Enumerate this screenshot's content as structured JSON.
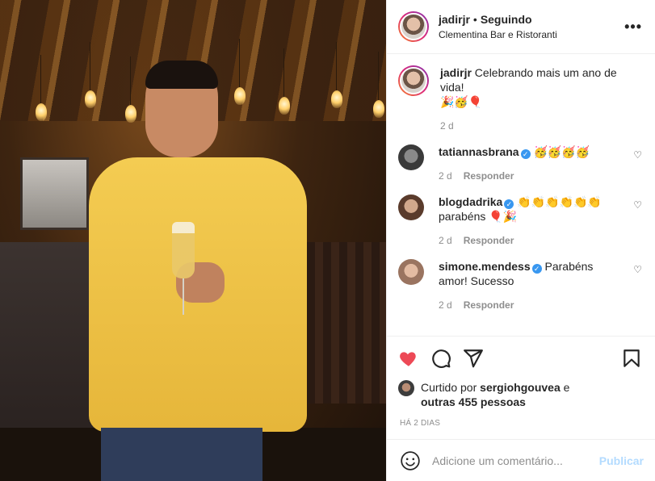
{
  "header": {
    "username": "jadirjr",
    "separator": "•",
    "follow_status": "Seguindo",
    "location": "Clementina Bar e Ristoranti",
    "more_label": "•••"
  },
  "caption": {
    "username": "jadirjr",
    "text": "Celebrando mais um ano de vida!",
    "emojis": "🎉🥳🎈",
    "time": "2 d"
  },
  "comments": [
    {
      "username": "tatiannasbrana",
      "verified": true,
      "text": "🥳🥳🥳🥳",
      "time": "2 d",
      "reply_label": "Responder"
    },
    {
      "username": "blogdadrika",
      "verified": true,
      "text": "👏👏👏👏👏👏 parabéns 🎈🎉",
      "time": "2 d",
      "reply_label": "Responder"
    },
    {
      "username": "simone.mendess",
      "verified": true,
      "text": "Parabéns amor! Sucesso",
      "time": "2 d",
      "reply_label": "Responder"
    }
  ],
  "likes": {
    "prefix": "Curtido por",
    "user": "sergiohgouvea",
    "conj": "e",
    "others": "outras 455 pessoas"
  },
  "posted_ago": "HÁ 2 DIAS",
  "add_comment": {
    "placeholder": "Adicione um comentário...",
    "post_label": "Publicar"
  },
  "colors": {
    "like_red": "#ed4956",
    "verified_blue": "#3897f0",
    "publish_disabled": "#b3dbff"
  },
  "verified_mark": "✓"
}
